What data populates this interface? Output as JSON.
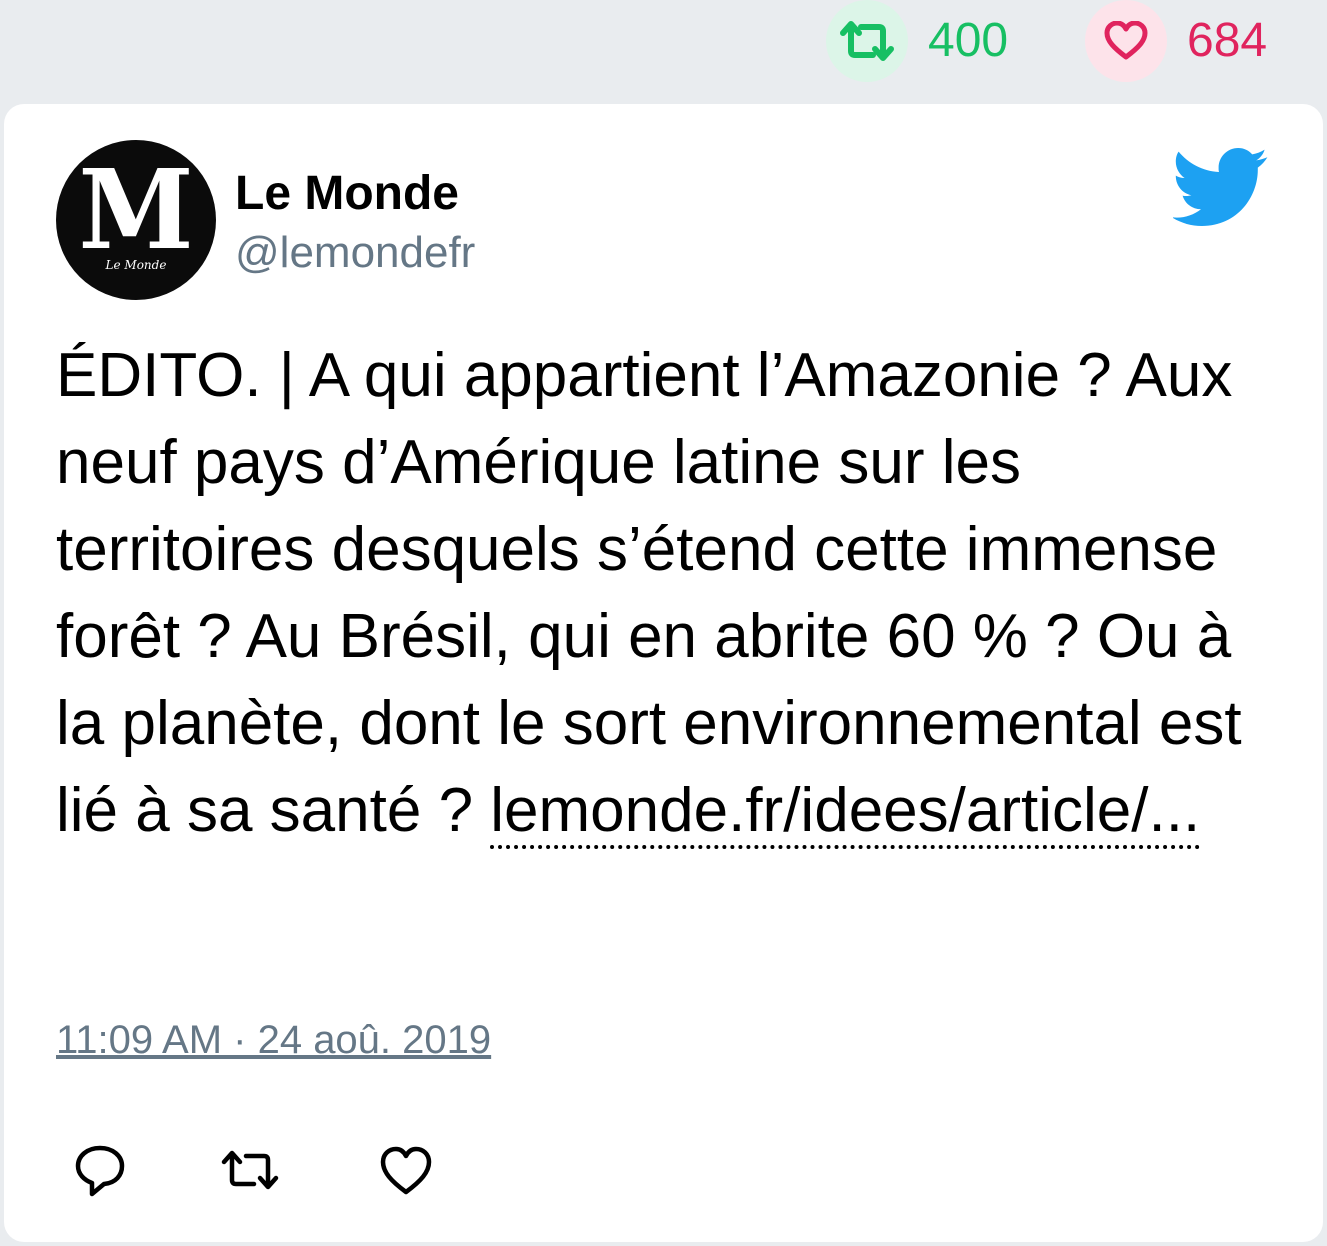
{
  "stats": {
    "retweet_count": "400",
    "like_count": "684",
    "retweet_color": "#17bf63",
    "like_color": "#e0245e"
  },
  "author": {
    "name": "Le Monde",
    "handle": "@lemondefr",
    "avatar_letter": "M",
    "avatar_caption": "Le Monde"
  },
  "tweet": {
    "text": "ÉDITO. | A qui appartient l’Amazonie ? Aux neuf pays d’Amérique latine sur les territoires desquels s’étend cette immense forêt ? Au Brésil, qui en abrite 60 % ? Ou à la planète, dont le sort environnemental est lié à sa santé ?",
    "link": "lemonde.fr/idees/article/...",
    "timestamp": "11:09 AM · 24 aoû. 2019"
  },
  "icons": {
    "brand": "twitter-bird-icon",
    "brand_color": "#1da1f2",
    "actions": [
      "reply-icon",
      "retweet-icon",
      "like-icon"
    ]
  }
}
